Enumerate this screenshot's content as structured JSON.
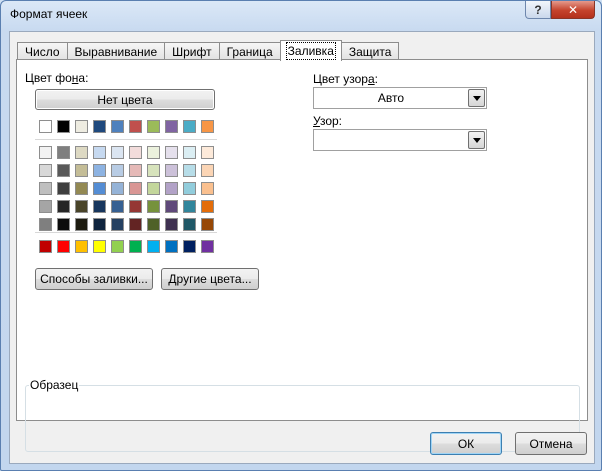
{
  "window": {
    "title": "Формат ячеек",
    "help_glyph": "?",
    "close_glyph": "✕"
  },
  "tabs": [
    {
      "label": "Число",
      "active": false
    },
    {
      "label": "Выравнивание",
      "active": false
    },
    {
      "label": "Шрифт",
      "active": false
    },
    {
      "label": "Граница",
      "active": false
    },
    {
      "label": "Заливка",
      "active": true
    },
    {
      "label": "Защита",
      "active": false
    }
  ],
  "fill": {
    "background_label": "Цвет фона:",
    "no_color_button": "Нет цвета",
    "fill_effects_button": "Способы заливки...",
    "more_colors_button": "Другие цвета...",
    "theme_top_row": [
      "#ffffff",
      "#000000",
      "#eeece1",
      "#1f497d",
      "#4f81bd",
      "#c0504d",
      "#9bbb59",
      "#8064a2",
      "#4bacc6",
      "#f79646"
    ],
    "theme_shades": [
      [
        "#f2f2f2",
        "#7f7f7f",
        "#ddd9c3",
        "#c6d9f0",
        "#dbe5f1",
        "#f2dcdb",
        "#ebf1dd",
        "#e5e0ec",
        "#dbeef3",
        "#fdeada"
      ],
      [
        "#d8d8d8",
        "#595959",
        "#c4bd97",
        "#8db3e2",
        "#b8cce4",
        "#e5b9b7",
        "#d7e3bc",
        "#ccc1d9",
        "#b7dde8",
        "#fbd5b5"
      ],
      [
        "#bfbfbf",
        "#3f3f3f",
        "#938953",
        "#548dd4",
        "#95b3d7",
        "#d99694",
        "#c3d69b",
        "#b2a2c7",
        "#92cddc",
        "#fac08f"
      ],
      [
        "#a5a5a5",
        "#262626",
        "#494429",
        "#17365d",
        "#366092",
        "#953734",
        "#76923c",
        "#5f497a",
        "#31859b",
        "#e36c09"
      ],
      [
        "#7f7f7f",
        "#0c0c0c",
        "#1d1b10",
        "#0f243e",
        "#244061",
        "#632423",
        "#4f6128",
        "#3f3151",
        "#205867",
        "#974806"
      ]
    ],
    "standard_colors": [
      "#c00000",
      "#ff0000",
      "#ffc000",
      "#ffff00",
      "#92d050",
      "#00b050",
      "#00b0f0",
      "#0070c0",
      "#002060",
      "#7030a0"
    ]
  },
  "pattern": {
    "color_label": "Цвет узора:",
    "color_value": "Авто",
    "style_label": "Узор:",
    "style_value": ""
  },
  "sample": {
    "label": "Образец"
  },
  "footer": {
    "ok": "ОК",
    "cancel": "Отмена"
  }
}
